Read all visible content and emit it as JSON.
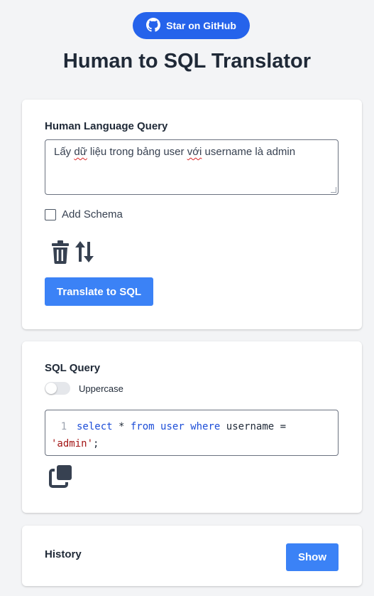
{
  "github_button": {
    "label": "Star on GitHub"
  },
  "page_title": "Human to SQL Translator",
  "input_card": {
    "label": "Human Language Query",
    "query_parts": [
      "Lấy ",
      "dữ",
      " liệu trong bảng user ",
      "với",
      " username là admin"
    ],
    "add_schema_label": "Add Schema",
    "add_schema_checked": false,
    "translate_button": "Translate to SQL"
  },
  "output_card": {
    "label": "SQL Query",
    "uppercase_label": "Uppercase",
    "uppercase_on": false,
    "line_number": "1",
    "sql_tokens": {
      "select": "select",
      "star": " * ",
      "from": "from",
      "table": "user",
      "where": "where",
      "rest": " username =",
      "value": "'admin'",
      "end": ";"
    }
  },
  "history_card": {
    "label": "History",
    "show_button": "Show"
  },
  "colors": {
    "primary": "#3b82f6",
    "github": "#2563eb"
  }
}
